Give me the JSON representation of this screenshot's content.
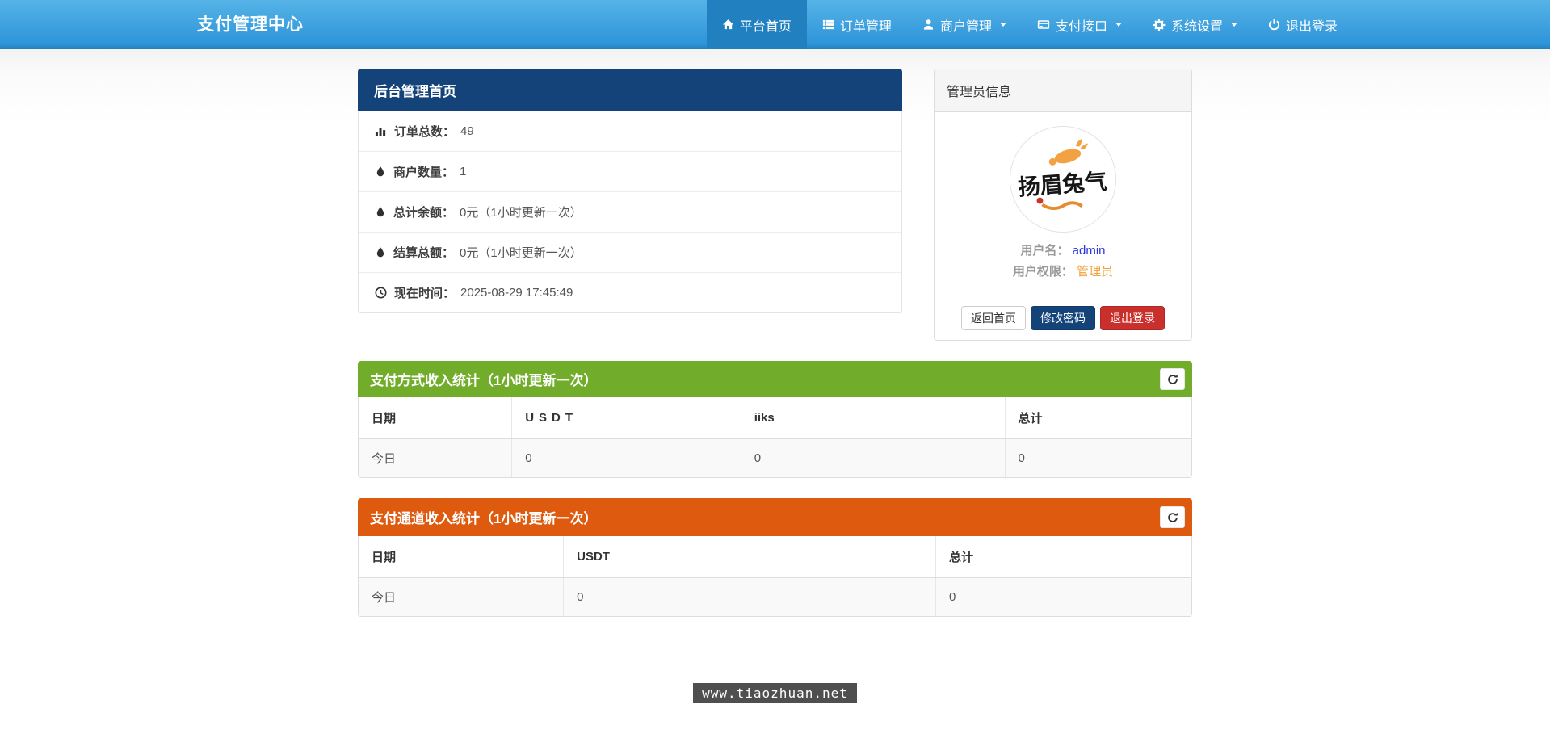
{
  "navbar": {
    "brand": "支付管理中心",
    "items": [
      {
        "label": "平台首页",
        "icon": "home-icon",
        "active": true,
        "dropdown": false
      },
      {
        "label": "订单管理",
        "icon": "list-icon",
        "active": false,
        "dropdown": false
      },
      {
        "label": "商户管理",
        "icon": "user-icon",
        "active": false,
        "dropdown": true
      },
      {
        "label": "支付接口",
        "icon": "credit-card-icon",
        "active": false,
        "dropdown": true
      },
      {
        "label": "系统设置",
        "icon": "gear-icon",
        "active": false,
        "dropdown": true
      },
      {
        "label": "退出登录",
        "icon": "power-icon",
        "active": false,
        "dropdown": false
      }
    ]
  },
  "dashboard_panel": {
    "title": "后台管理首页",
    "rows": [
      {
        "icon": "bar-chart-icon",
        "label": "订单总数：",
        "value": "49"
      },
      {
        "icon": "droplet-icon",
        "label": "商户数量：",
        "value": "1"
      },
      {
        "icon": "droplet-icon",
        "label": "总计余额：",
        "value": "0元（1小时更新一次）"
      },
      {
        "icon": "droplet-icon",
        "label": "结算总额：",
        "value": "0元（1小时更新一次）"
      },
      {
        "icon": "clock-icon",
        "label": "现在时间：",
        "value": "2025-08-29 17:45:49"
      }
    ]
  },
  "admin_panel": {
    "title": "管理员信息",
    "avatar": "calligraphy-rabbit-artwork",
    "username_label": "用户名：",
    "username": "admin",
    "role_label": "用户权限：",
    "role": "管理员",
    "buttons": [
      {
        "label": "返回首页",
        "style": "default"
      },
      {
        "label": "修改密码",
        "style": "primary"
      },
      {
        "label": "退出登录",
        "style": "danger"
      }
    ]
  },
  "payment_method_stats": {
    "title": "支付方式收入统计（1小时更新一次）",
    "refresh_icon": "refresh-icon",
    "columns": [
      "日期",
      "USDT",
      "iiks",
      "总计"
    ],
    "rows": [
      [
        "今日",
        "0",
        "0",
        "0"
      ]
    ]
  },
  "payment_channel_stats": {
    "title": "支付通道收入统计（1小时更新一次）",
    "refresh_icon": "refresh-icon",
    "columns": [
      "日期",
      "USDT",
      "总计"
    ],
    "rows": [
      [
        "今日",
        "0",
        "0"
      ]
    ]
  },
  "watermark": {
    "text": "www.tiaozhuan.net"
  },
  "colors": {
    "navbar-top": "#55b3e6",
    "navbar-bottom": "#2f95da",
    "navbar-active": "#2180c0",
    "panel-navy": "#14437a",
    "stats-green": "#71ad2b",
    "stats-orange": "#dd5a0f",
    "danger-red": "#c9302c",
    "link-blue": "#2b36e0",
    "role-orange": "#f0a43c",
    "watermark-bg": "#4f4f4f"
  }
}
